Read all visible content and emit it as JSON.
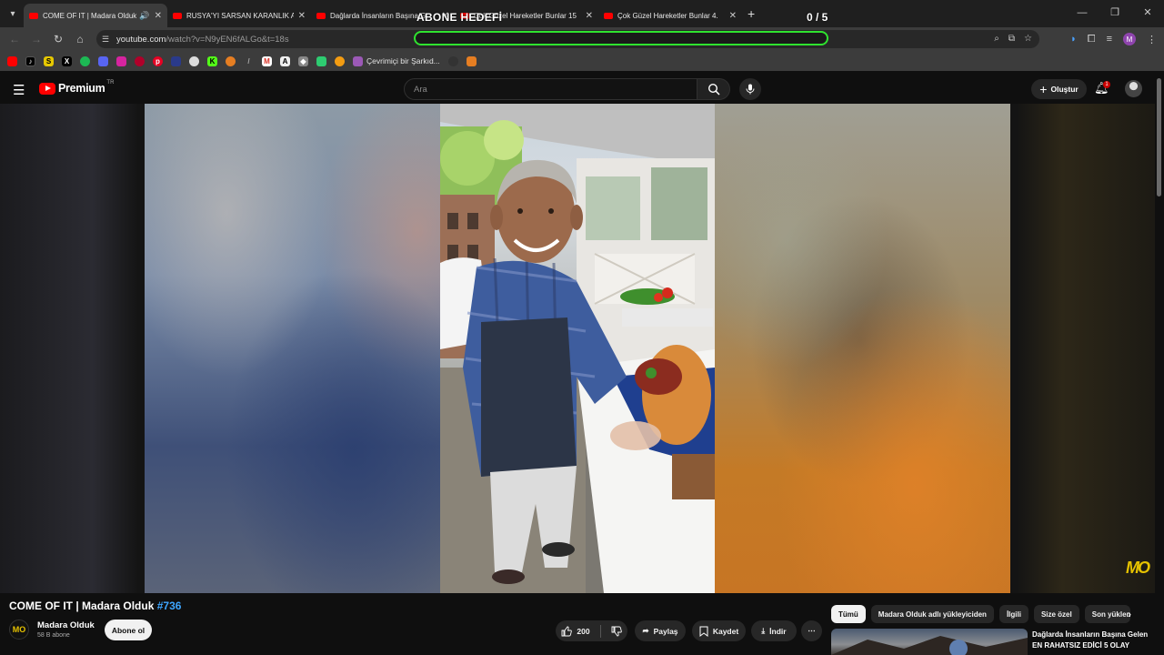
{
  "browser": {
    "tabs": [
      {
        "title": "COME OF IT | Madara Olduk",
        "active": true,
        "audio": true
      },
      {
        "title": "RUSYA'YI SARSAN KARANLIK A",
        "active": false
      },
      {
        "title": "Dağlarda İnsanların Başına G",
        "active": false
      },
      {
        "title": "Çok Güzel Hareketler Bunlar 15",
        "active": false
      },
      {
        "title": "Çok Güzel Hareketler Bunlar 4.",
        "active": false
      }
    ],
    "url_host": "youtube.com",
    "url_path": "/watch?v=N9yEN6fALGo&t=18s",
    "bookmark_label": "Çevrimiçi bir Şarkıd..."
  },
  "overlay": {
    "goal_title": "ABONE HEDEFİ",
    "goal_count": "0 / 5",
    "goal_progress": 0,
    "accent": "#2fe22f"
  },
  "header": {
    "brand": "Premium",
    "country": "TR",
    "search_placeholder": "Ara",
    "create_label": "Oluştur",
    "notification_count": "1"
  },
  "video": {
    "title": "COME OF IT | Madara Olduk",
    "hashtag": "#736",
    "watermark": "MO"
  },
  "channel": {
    "name": "Madara Olduk",
    "subscribers": "58 B abone",
    "logo_text": "MO",
    "subscribe_label": "Abone ol"
  },
  "actions": {
    "likes": "200",
    "share": "Paylaş",
    "save": "Kaydet",
    "download": "İndir"
  },
  "chips": [
    "Tümü",
    "Madara Olduk adlı yükleyiciden",
    "İlgili",
    "Size özel",
    "Son yüklene"
  ],
  "recommendation": {
    "title": "Dağlarda İnsanların Başına Gelen EN RAHATSIZ EDİCİ 5 OLAY"
  }
}
